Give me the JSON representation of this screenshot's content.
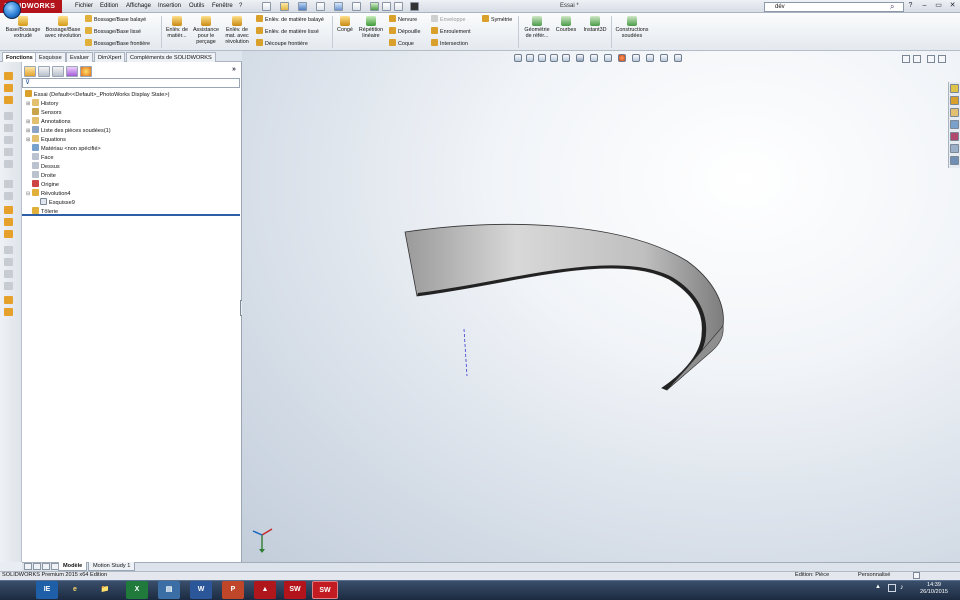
{
  "titlebar": {
    "logo": "SOLIDWORKS",
    "menus": [
      "Fichier",
      "Edition",
      "Affichage",
      "Insertion",
      "Outils",
      "Fenêtre",
      "?"
    ],
    "document_title": "Essai *",
    "search_value": "dév",
    "window_buttons": [
      "?",
      "–",
      "▭",
      "✕"
    ]
  },
  "commands": {
    "boss_extrude": "Base/Bossage extrudé",
    "boss_revolve": "Bossage/Base avec révolution",
    "boss_sweep": "Bossage/Base balayé",
    "boss_loft": "Bossage/Base lissé",
    "boss_boundary": "Bossage/Base frontière",
    "cut_extrude": "Enlèv. de matièr...",
    "hole_wizard": "Assistance pour le perçage",
    "cut_revolve": "Enlèv. de mat. avec révolution",
    "cut_sweep": "Enlèv. de matière balayé",
    "cut_loft": "Enlèv. de matière lissé",
    "cut_boundary": "Découpe frontière",
    "fillet": "Congé",
    "linear_pattern": "Répétition linéaire",
    "rib": "Nervure",
    "draft": "Dépouille",
    "shell": "Coque",
    "wrap": "Enveloppe",
    "wrap2": "Enroulement",
    "intersect": "Intersection",
    "mirror": "Symétrie",
    "ref_geometry": "Géométrie de référ...",
    "curves": "Courbes",
    "instant3d": "Instant3D",
    "weldments": "Constructions soudées"
  },
  "tabs": [
    "Fonctions",
    "Esquisse",
    "Evaluer",
    "DimXpert",
    "Compléments de SOLIDWORKS"
  ],
  "tree": {
    "root": "Essai  (Default<<Default>_PhotoWorks Display State>)",
    "items": [
      "History",
      "Sensors",
      "Annotations",
      "Liste des pièces soudées(1)",
      "Equations",
      "Matériau <non spécifié>",
      "Face",
      "Dessus",
      "Droite",
      "Origine",
      "Révolution4",
      "Esquisse9",
      "Tôlerie"
    ]
  },
  "bottom_tabs": [
    "Modèle",
    "Motion Study 1"
  ],
  "status": {
    "edition": "SOLIDWORKS Premium 2015 x64 Edition",
    "mode": "Edition: Pièce",
    "units": "Personnalisé"
  },
  "taskbar": {
    "apps": [
      "IE",
      "📁",
      "X",
      "▤",
      "W",
      "P",
      "▲",
      "SW",
      "SW"
    ],
    "time": "14:39",
    "date": "26/10/2015"
  },
  "colors": {
    "brand": "#b3141c",
    "rollback_bar": "#2d5fa6",
    "model_face": "#bdbdbd"
  }
}
